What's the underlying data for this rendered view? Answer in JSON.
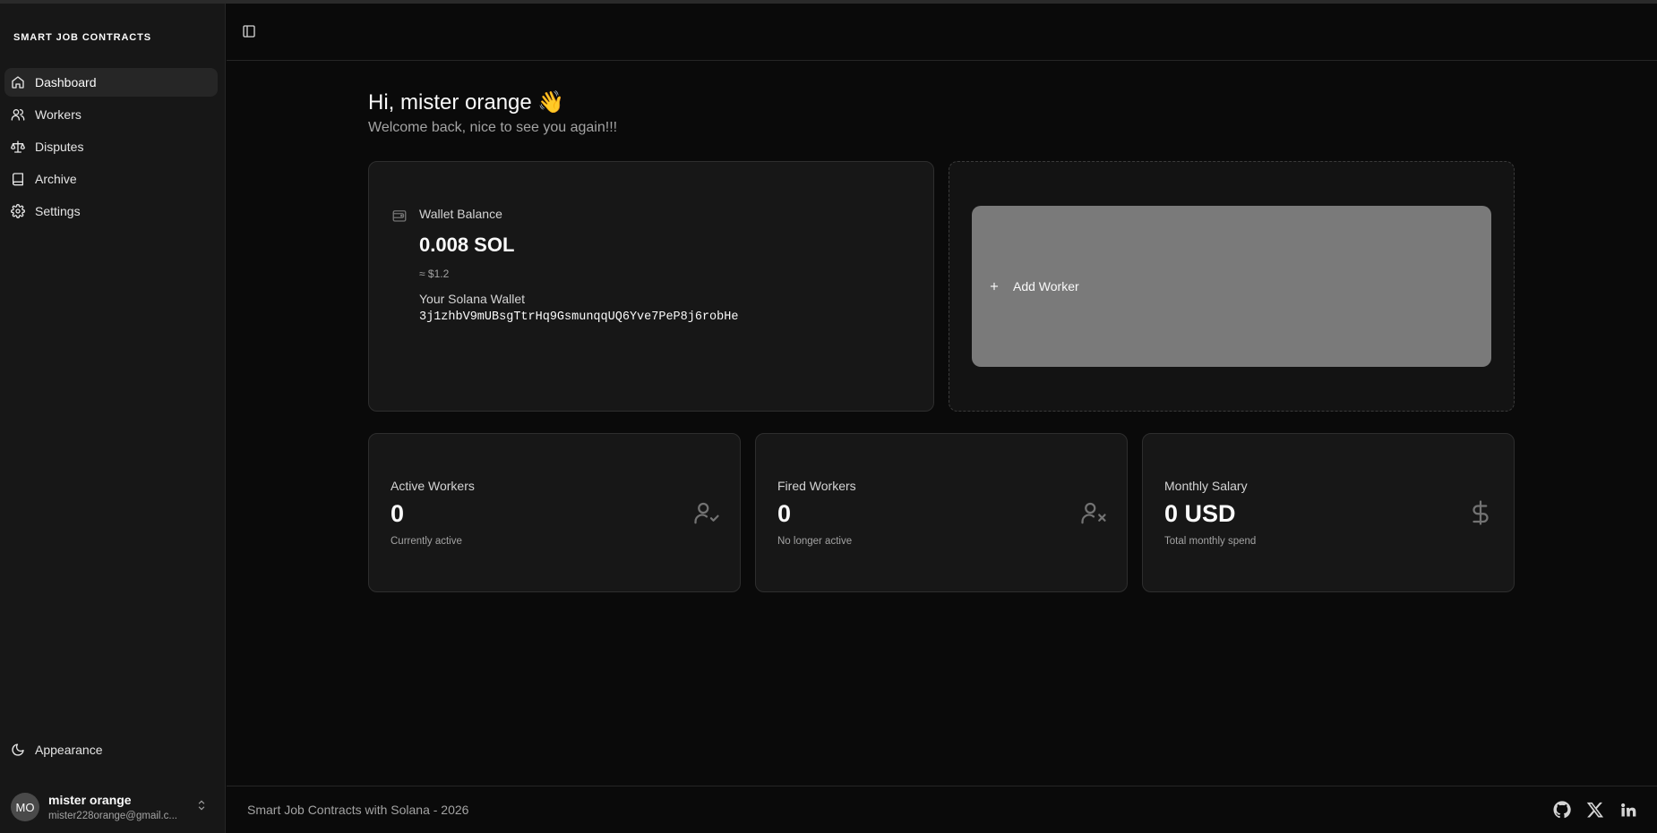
{
  "sidebar": {
    "brand": "SMART JOB CONTRACTS",
    "items": [
      {
        "label": "Dashboard",
        "icon": "home-icon",
        "active": true
      },
      {
        "label": "Workers",
        "icon": "users-icon"
      },
      {
        "label": "Disputes",
        "icon": "scale-icon"
      },
      {
        "label": "Archive",
        "icon": "book-icon"
      },
      {
        "label": "Settings",
        "icon": "gear-icon"
      }
    ],
    "appearance": "Appearance",
    "user": {
      "initials": "MO",
      "name": "mister orange",
      "email": "mister228orange@gmail.c..."
    }
  },
  "main": {
    "greeting": "Hi, mister orange 👋",
    "subtitle": "Welcome back, nice to see you again!!!",
    "wallet": {
      "label": "Wallet Balance",
      "balance": "0.008 SOL",
      "usd": "≈ $1.2",
      "wallet_label": "Your Solana Wallet",
      "address": "3j1zhbV9mUBsgTtrHq9GsmunqqUQ6Yve7PeP8j6robHe"
    },
    "add_worker": "Add Worker",
    "stats": [
      {
        "label": "Active Workers",
        "value": "0",
        "sub": "Currently active",
        "icon": "user-check-icon"
      },
      {
        "label": "Fired Workers",
        "value": "0",
        "sub": "No longer active",
        "icon": "user-x-icon"
      },
      {
        "label": "Monthly Salary",
        "value": "0 USD",
        "sub": "Total monthly spend",
        "icon": "dollar-icon"
      }
    ]
  },
  "footer": {
    "text": "Smart Job Contracts with Solana - 2026"
  }
}
